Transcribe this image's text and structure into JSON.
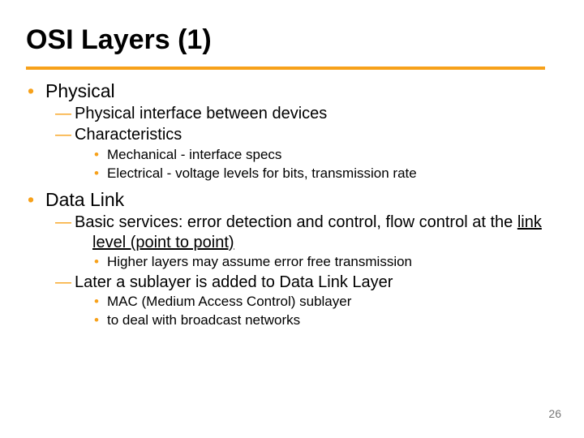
{
  "title": "OSI Layers (1)",
  "page_number": "26",
  "physical": {
    "heading": "Physical",
    "sub1": "Physical interface between devices",
    "sub2": "Characteristics",
    "char1": "Mechanical - interface specs",
    "char2": "Electrical - voltage levels for bits, transmission rate"
  },
  "datalink": {
    "heading": "Data Link",
    "services_before": "Basic services: error detection and control, flow control at the ",
    "services_underlined": "link level (point to point)",
    "higher": "Higher layers may assume error free transmission",
    "sublayer": "Later a sublayer is added to Data Link Layer",
    "mac1": "MAC (Medium Access Control) sublayer",
    "mac2": "to deal with broadcast networks"
  }
}
